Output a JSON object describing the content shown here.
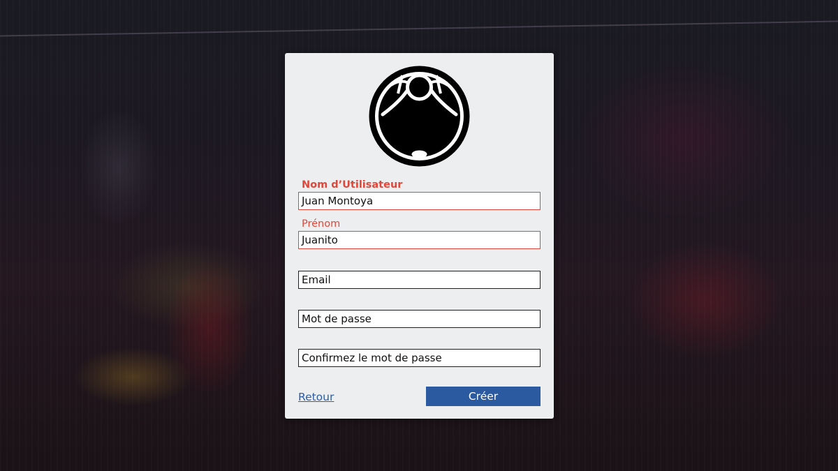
{
  "form": {
    "username": {
      "label": "Nom d’Utilisateur",
      "value": "Juan Montoya",
      "state": "error"
    },
    "firstname": {
      "label": "Prénom",
      "value": "Juanito",
      "state": "error"
    },
    "email": {
      "placeholder": "Email"
    },
    "password": {
      "placeholder": "Mot de passe"
    },
    "confirm_password": {
      "placeholder": "Confirmez le mot de passe"
    }
  },
  "actions": {
    "back_label": "Retour",
    "create_label": "Créer"
  },
  "icons": {
    "logo": "emblem-logo-icon"
  },
  "colors": {
    "error": "#e0473a",
    "primary": "#2c5aa0",
    "link": "#2d5ea8",
    "card_background": "#eceeef"
  }
}
